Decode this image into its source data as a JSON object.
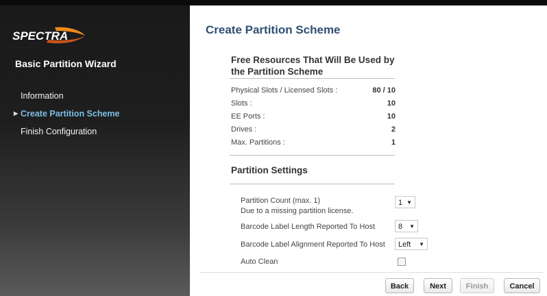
{
  "brand": {
    "logo_text": "SPECTRA"
  },
  "sidebar": {
    "wizard_title": "Basic Partition Wizard",
    "items": [
      {
        "label": "Information",
        "active": false
      },
      {
        "label": "Create Partition Scheme",
        "active": true
      },
      {
        "label": "Finish Configuration",
        "active": false
      }
    ]
  },
  "main": {
    "page_title": "Create Partition Scheme",
    "resources": {
      "title": "Free Resources That Will Be Used by the Partition Scheme",
      "rows": [
        {
          "label": "Physical Slots / Licensed Slots :",
          "value": "80 / 10"
        },
        {
          "label": "Slots :",
          "value": "10"
        },
        {
          "label": "EE Ports :",
          "value": "10"
        },
        {
          "label": "Drives :",
          "value": "2"
        },
        {
          "label": "Max. Partitions :",
          "value": "1"
        }
      ]
    },
    "settings": {
      "title": "Partition Settings",
      "partition_count_label": "Partition Count (max. 1)",
      "partition_count_note": "Due to a missing partition license.",
      "partition_count_value": "1",
      "barcode_length_label": "Barcode Label Length Reported To Host",
      "barcode_length_value": "8",
      "barcode_alignment_label": "Barcode Label Alignment Reported To Host",
      "barcode_alignment_value": "Left",
      "auto_clean_label": "Auto Clean",
      "auto_clean_checked": false
    },
    "buttons": {
      "back": "Back",
      "next": "Next",
      "finish": "Finish",
      "cancel": "Cancel"
    }
  },
  "colors": {
    "title_blue": "#2f4f73",
    "active_nav": "#7fbde8",
    "logo_orange": "#f08a1c"
  }
}
